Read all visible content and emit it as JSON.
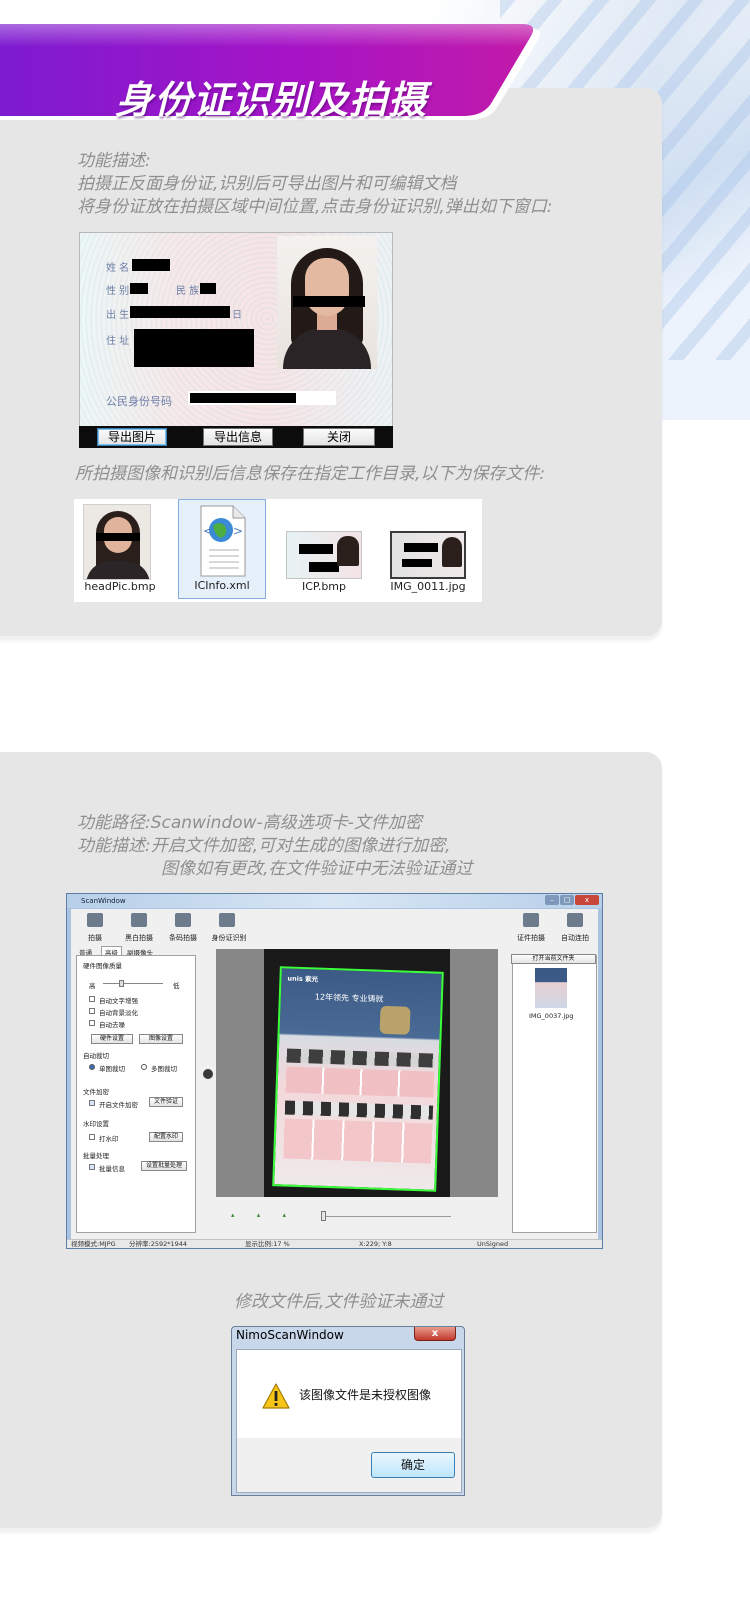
{
  "banner": {
    "title": "身份证识别及拍摄"
  },
  "section1": {
    "desc_line1": "功能描述:",
    "desc_line2": "拍摄正反面身份证,识别后可导出图片和可编辑文档",
    "desc_line3": "将身份证放在拍摄区域中间位置,点击身份证识别,弹出如下窗口:",
    "id_card": {
      "field_name": "姓  名",
      "field_gender": "性  别",
      "field_ethnic": "民  族",
      "field_birth": "出  生",
      "field_birth_suffix": "日",
      "field_address": "住  址",
      "field_id_number": "公民身份号码",
      "buttons": [
        "导出图片",
        "导出信息",
        "关闭"
      ]
    },
    "save_note": "所拍摄图像和识别后信息保存在指定工作目录,以下为保存文件:",
    "files": [
      "headPic.bmp",
      "ICInfo.xml",
      "ICP.bmp",
      "IMG_0011.jpg"
    ]
  },
  "section2": {
    "path_line": "功能路径:Scanwindow-高级选项卡-文件加密",
    "desc_line1": "功能描述:开启文件加密,可对生成的图像进行加密,",
    "desc_line2": "图像如有更改,在文件验证中无法验证通过",
    "scanwindow": {
      "title": "ScanWindow",
      "toolbar": [
        "拍摄",
        "黑白拍摄",
        "条码拍摄",
        "身份证识别",
        "证件拍摄",
        "自动连拍"
      ],
      "tabs": [
        "普通",
        "高级",
        "副摄像头"
      ],
      "group_hw": "硬件图像质量",
      "quality_high": "高",
      "quality_low": "低",
      "checks": [
        "自动文字增强",
        "自动背景淡化",
        "自动去噪"
      ],
      "btn_hw": "硬件设置",
      "btn_img": "图像设置",
      "group_crop": "自动裁切",
      "radio_single": "单图裁切",
      "radio_multi": "多图裁切",
      "group_encrypt": "文件加密",
      "check_encrypt": "开启文件加密",
      "btn_verify": "文件验证",
      "group_watermark": "水印设置",
      "check_watermark": "打水印",
      "btn_watermark": "配置水印",
      "group_batch": "批量处理",
      "check_batch": "批量信息",
      "btn_batch": "设置批量处理",
      "open_folder": "打开当前文件夹",
      "thumb_name": "IMG_0037.jpg",
      "doc_brand": "unis 紫光",
      "doc_slogan": "12年领先 专业铸就",
      "status_video": "视频模式:MJPG",
      "status_res": "分辨率:2592*1944",
      "status_ratio": "显示比例:17 %",
      "status_xy": "X:229; Y:8",
      "status_sign": "UnSigned"
    },
    "modify_note": "修改文件后,文件验证未通过",
    "dialog": {
      "title": "NimoScanWindow",
      "message": "该图像文件是未授权图像",
      "ok": "确定"
    }
  }
}
